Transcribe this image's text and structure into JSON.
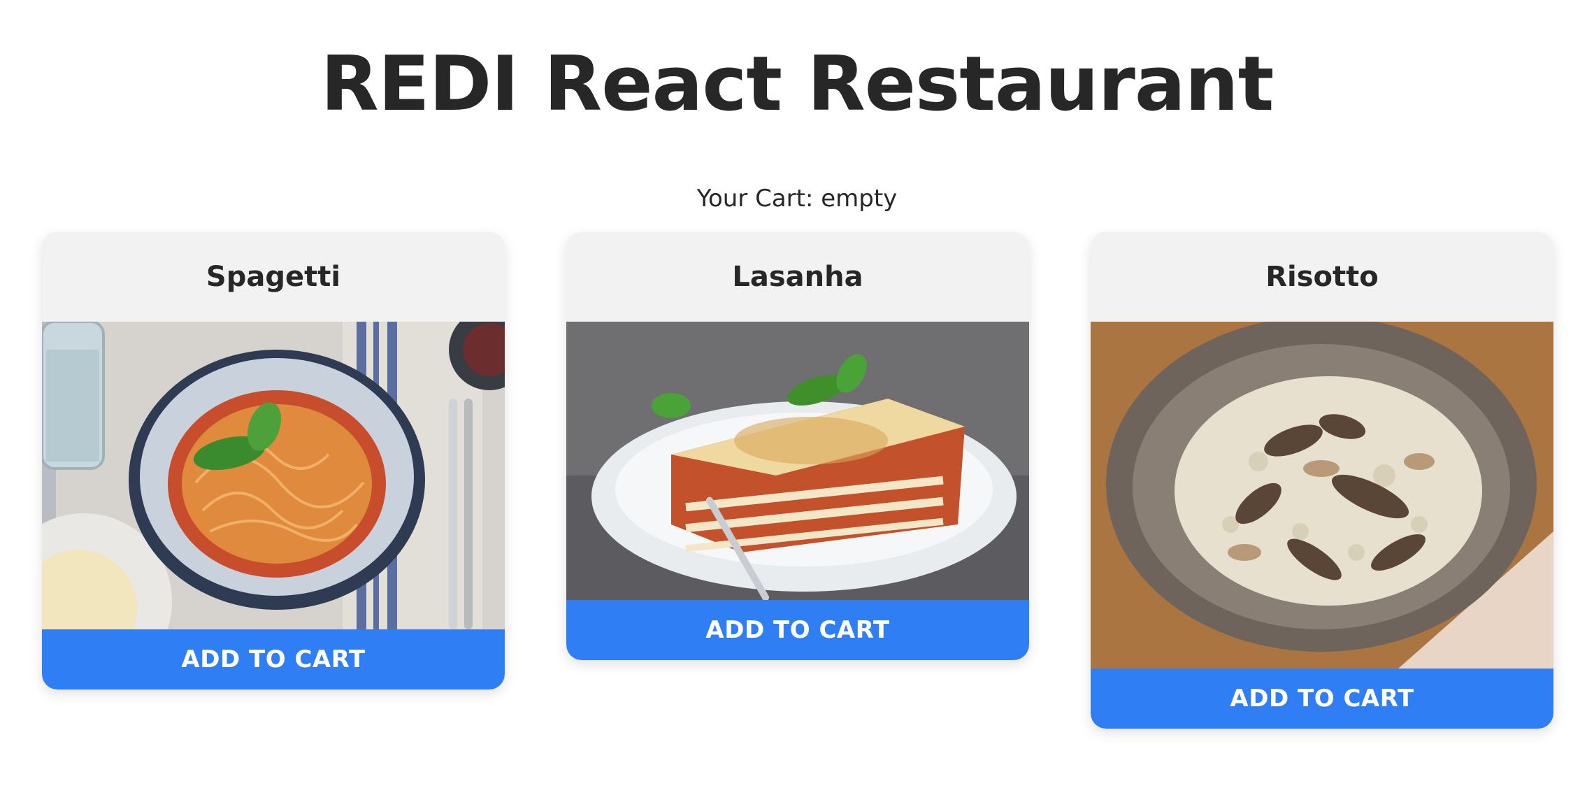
{
  "title": "REDI React Restaurant",
  "cart": {
    "label": "Your Cart: empty"
  },
  "menu": [
    {
      "name": "Spagetti",
      "button": "ADD TO CART"
    },
    {
      "name": "Lasanha",
      "button": "ADD TO CART"
    },
    {
      "name": "Risotto",
      "button": "ADD TO CART"
    }
  ],
  "colors": {
    "accent": "#307ef4",
    "card_bg": "#f2f2f2",
    "text": "#272727"
  }
}
